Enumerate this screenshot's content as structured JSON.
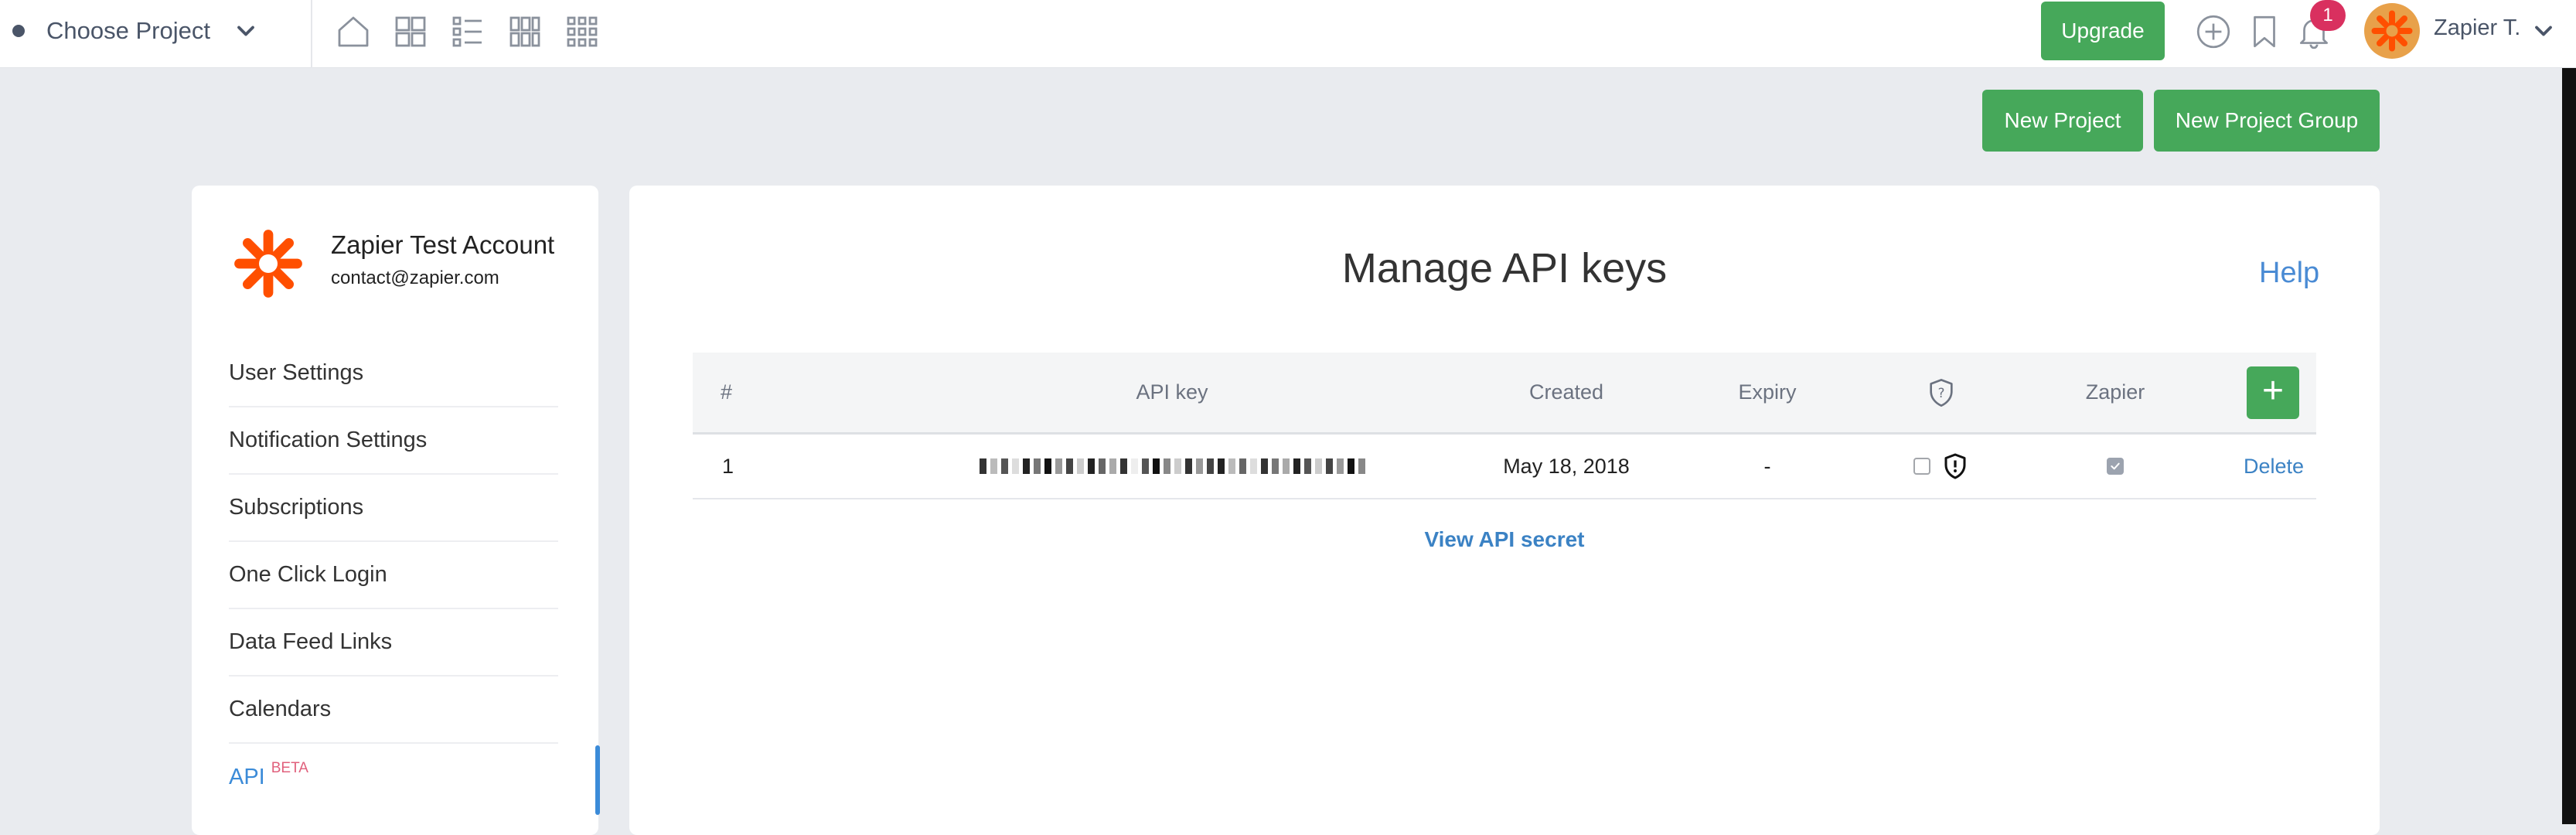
{
  "topbar": {
    "project_label": "Choose Project",
    "view_icons": [
      "home-icon",
      "grid-icon",
      "list-icon",
      "columns-icon",
      "apps-icon"
    ],
    "upgrade_label": "Upgrade",
    "notification_count": "1",
    "user_name": "Zapier T."
  },
  "actions": {
    "new_project": "New Project",
    "new_project_group": "New Project Group"
  },
  "sidebar": {
    "account_name": "Zapier Test Account",
    "account_email": "contact@zapier.com",
    "items": [
      {
        "label": "User Settings"
      },
      {
        "label": "Notification Settings"
      },
      {
        "label": "Subscriptions"
      },
      {
        "label": "One Click Login"
      },
      {
        "label": "Data Feed Links"
      },
      {
        "label": "Calendars"
      },
      {
        "label": "API",
        "badge": "BETA",
        "active": true
      }
    ]
  },
  "main": {
    "title": "Manage API keys",
    "help_label": "Help",
    "table": {
      "headers": [
        "#",
        "API key",
        "Created",
        "Expiry",
        "",
        "Zapier"
      ],
      "rows": [
        {
          "num": "1",
          "created": "May 18, 2018",
          "expiry": "-",
          "shield_checked": false,
          "zapier_checked": true,
          "action": "Delete"
        }
      ]
    },
    "view_secret_label": "View API secret"
  },
  "colors": {
    "brand_green": "#46a85a",
    "link_blue": "#3b82c4",
    "zapier_orange": "#ff4f00",
    "badge_pink": "#d9305f"
  }
}
